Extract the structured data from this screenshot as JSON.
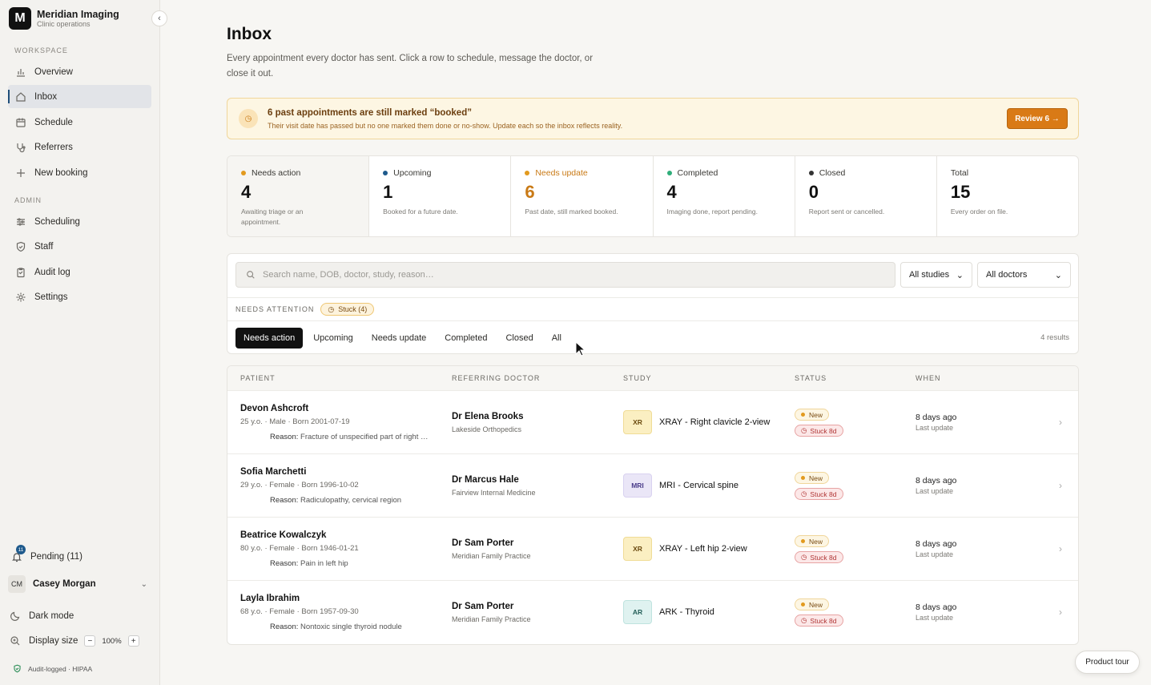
{
  "brand": {
    "logo_letter": "M",
    "name": "Meridian Imaging",
    "subtitle": "Clinic operations"
  },
  "sidebar": {
    "workspace_label": "WORKSPACE",
    "admin_label": "ADMIN",
    "workspace_items": [
      {
        "label": "Overview",
        "icon": "bar-chart-icon"
      },
      {
        "label": "Inbox",
        "icon": "home-icon",
        "active": true
      },
      {
        "label": "Schedule",
        "icon": "calendar-icon"
      },
      {
        "label": "Referrers",
        "icon": "stethoscope-icon"
      },
      {
        "label": "New booking",
        "icon": "plus-icon"
      }
    ],
    "admin_items": [
      {
        "label": "Scheduling",
        "icon": "sliders-icon"
      },
      {
        "label": "Staff",
        "icon": "shield-icon"
      },
      {
        "label": "Audit log",
        "icon": "clipboard-icon"
      },
      {
        "label": "Settings",
        "icon": "gear-icon"
      }
    ],
    "pending": {
      "label": "Pending (11)",
      "badge": "11"
    },
    "user": {
      "initials": "CM",
      "name": "Casey Morgan"
    },
    "dark_mode_label": "Dark mode",
    "display_size": {
      "label": "Display size",
      "minus": "−",
      "value": "100%",
      "plus": "+"
    },
    "compliance": "Audit-logged · HIPAA"
  },
  "page": {
    "title": "Inbox",
    "description": "Every appointment every doctor has sent. Click a row to schedule, message the doctor, or close it out."
  },
  "alert": {
    "title": "6 past appointments are still marked “booked”",
    "subtitle": "Their visit date has passed but no one marked them done or no-show. Update each so the inbox reflects reality.",
    "button": "Review 6 →"
  },
  "stats": [
    {
      "label": "Needs action",
      "value": "4",
      "desc": "Awaiting triage or an appointment.",
      "dot": "#e29a1e",
      "value_color": "#111111"
    },
    {
      "label": "Upcoming",
      "value": "1",
      "desc": "Booked for a future date.",
      "dot": "#1e5a8c",
      "value_color": "#111111"
    },
    {
      "label": "Needs update",
      "value": "6",
      "desc": "Past date, still marked booked.",
      "dot": "#e29a1e",
      "value_color": "#c97a16",
      "label_color": "#c97a16"
    },
    {
      "label": "Completed",
      "value": "4",
      "desc": "Imaging done, report pending.",
      "dot": "#2fae7a",
      "value_color": "#111111"
    },
    {
      "label": "Closed",
      "value": "0",
      "desc": "Report sent or cancelled.",
      "dot": "#333333",
      "value_color": "#111111"
    },
    {
      "label": "Total",
      "value": "15",
      "desc": "Every order on file.",
      "dot": "",
      "value_color": "#111111"
    }
  ],
  "filters": {
    "search_placeholder": "Search name, DOB, doctor, study, reason…",
    "studies_select": "All studies",
    "doctors_select": "All doctors",
    "attention_label": "NEEDS ATTENTION",
    "stuck_pill": "Stuck (4)"
  },
  "tabs": [
    {
      "label": "Needs action",
      "active": true
    },
    {
      "label": "Upcoming"
    },
    {
      "label": "Needs update"
    },
    {
      "label": "Completed"
    },
    {
      "label": "Closed"
    },
    {
      "label": "All"
    }
  ],
  "results_count": "4 results",
  "table": {
    "headers": {
      "patient": "PATIENT",
      "doctor": "REFERRING DOCTOR",
      "study": "STUDY",
      "status": "STATUS",
      "when": "WHEN"
    },
    "rows": [
      {
        "name": "Devon Ashcroft",
        "meta": "25 y.o. · Male · Born 2001-07-19",
        "reason_label": "Reason:",
        "reason": "Fracture of unspecified part of right …",
        "doctor": "Dr Elena Brooks",
        "practice": "Lakeside Orthopedics",
        "study_code": "XR",
        "study_kind": "xr",
        "study": "XRAY - Right clavicle 2-view",
        "status_new": "New",
        "status_stuck": "Stuck 8d",
        "when": "8 days ago",
        "when_sub": "Last update"
      },
      {
        "name": "Sofia Marchetti",
        "meta": "29 y.o. · Female · Born 1996-10-02",
        "reason_label": "Reason:",
        "reason": "Radiculopathy, cervical region",
        "doctor": "Dr Marcus Hale",
        "practice": "Fairview Internal Medicine",
        "study_code": "MRI",
        "study_kind": "mri",
        "study": "MRI - Cervical spine",
        "status_new": "New",
        "status_stuck": "Stuck 8d",
        "when": "8 days ago",
        "when_sub": "Last update"
      },
      {
        "name": "Beatrice Kowalczyk",
        "meta": "80 y.o. · Female · Born 1946-01-21",
        "reason_label": "Reason:",
        "reason": "Pain in left hip",
        "doctor": "Dr Sam Porter",
        "practice": "Meridian Family Practice",
        "study_code": "XR",
        "study_kind": "xr",
        "study": "XRAY - Left hip 2-view",
        "status_new": "New",
        "status_stuck": "Stuck 8d",
        "when": "8 days ago",
        "when_sub": "Last update"
      },
      {
        "name": "Layla Ibrahim",
        "meta": "68 y.o. · Female · Born 1957-09-30",
        "reason_label": "Reason:",
        "reason": "Nontoxic single thyroid nodule",
        "doctor": "Dr Sam Porter",
        "practice": "Meridian Family Practice",
        "study_code": "AR",
        "study_kind": "ar",
        "study": "ARK - Thyroid",
        "status_new": "New",
        "status_stuck": "Stuck 8d",
        "when": "8 days ago",
        "when_sub": "Last update"
      }
    ]
  },
  "product_tour": "Product tour"
}
